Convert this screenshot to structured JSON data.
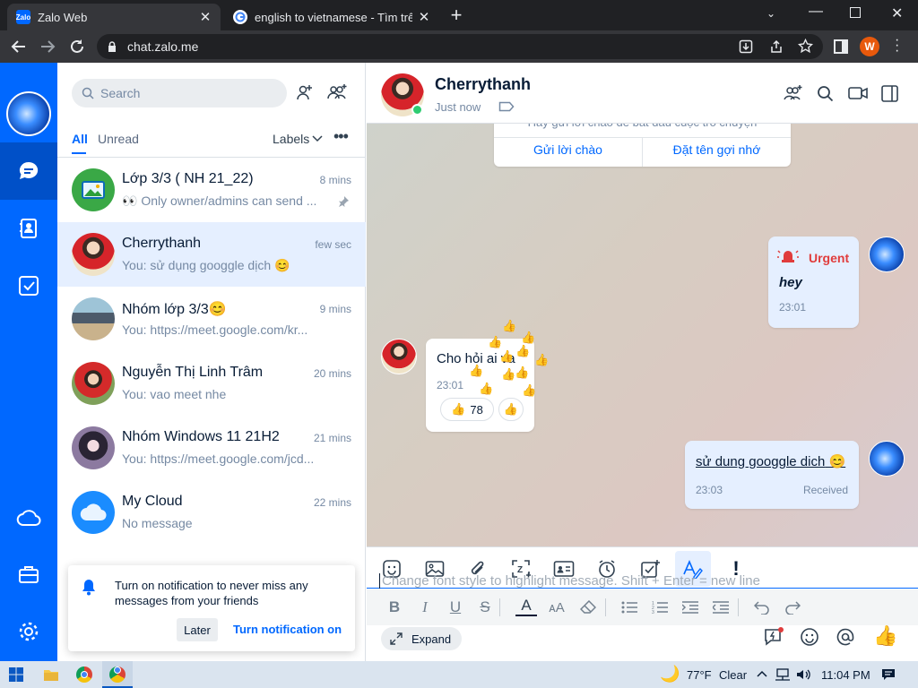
{
  "browser": {
    "tabs": [
      {
        "title": "Zalo Web",
        "favicon": "Zalo"
      },
      {
        "title": "english to vietnamese - Tìm trên"
      }
    ],
    "url": "chat.zalo.me",
    "profile_initial": "W"
  },
  "list": {
    "search_placeholder": "Search",
    "filter_all": "All",
    "filter_unread": "Unread",
    "labels": "Labels",
    "conversations": [
      {
        "name": "Lớp 3/3 ( NH 21_22)",
        "time": "8 mins",
        "preview": "👀 Only owner/admins can send ...",
        "pinned": true
      },
      {
        "name": "Cherrythanh",
        "time": "few sec",
        "preview": "You: sử dụng googgle dịch 😊",
        "selected": true
      },
      {
        "name": "Nhóm lớp 3/3😊",
        "time": "9 mins",
        "preview": "You: https://meet.google.com/kr..."
      },
      {
        "name": "Nguyễn Thị Linh Trâm",
        "time": "20 mins",
        "preview": "You: vao meet nhe"
      },
      {
        "name": "Nhóm Windows 11 21H2",
        "time": "21 mins",
        "preview": "You: https://meet.google.com/jcd..."
      },
      {
        "name": "My Cloud",
        "time": "22 mins",
        "preview": "No message"
      }
    ],
    "notification": {
      "text": "Turn on notification to never miss any messages from your friends",
      "later": "Later",
      "turn_on": "Turn notification on"
    }
  },
  "chat": {
    "contact_name": "Cherrythanh",
    "status": "Just now",
    "greeting_hint": "Hãy gửi lời chào để bắt đầu cuộc trò chuyện",
    "greet_button": "Gửi lời chào",
    "nickname_button": "Đặt tên gợi nhớ",
    "messages": [
      {
        "from": "me",
        "urgent_label": "Urgent",
        "text": "hey",
        "time": "23:01"
      },
      {
        "from": "them",
        "text": "Cho hỏi ai va",
        "time": "23:01",
        "reaction_count": "78"
      },
      {
        "from": "me",
        "text": "sử dung googgle dich",
        "time": "23:03",
        "status": "Received"
      }
    ],
    "compose_placeholder": "Change font style to highlight message. Shift + Enter = new line",
    "expand": "Expand"
  },
  "taskbar": {
    "temperature": "77°F",
    "weather": "Clear",
    "clock": "11:04 PM"
  },
  "colors": {
    "zalo_blue": "#0068ff",
    "urgent_red": "#e03c3c",
    "online_green": "#2ecc71"
  }
}
